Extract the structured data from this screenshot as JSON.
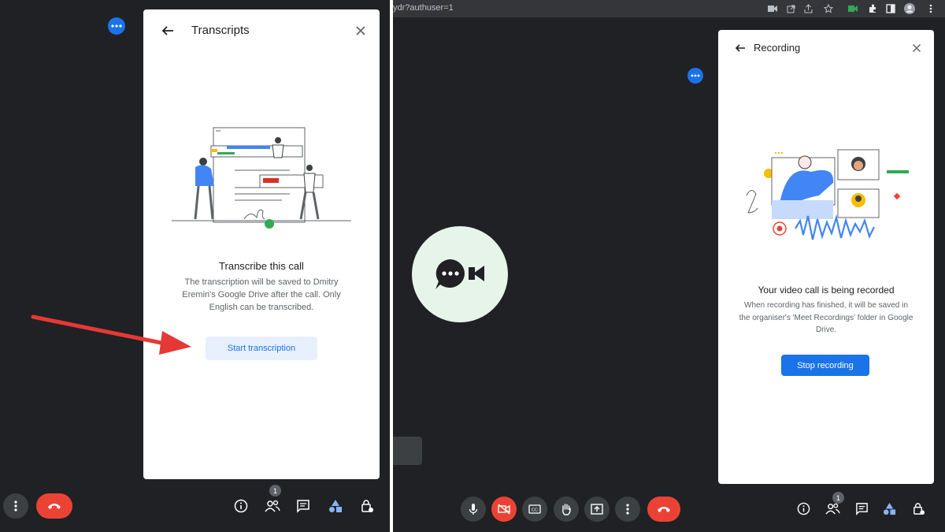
{
  "left": {
    "transcripts_panel": {
      "title": "Transcripts",
      "heading": "Transcribe this call",
      "description": "The transcription will be saved to Dmitry Eremin's Google Drive after the call. Only English can be transcribed.",
      "button_label": "Start transcription"
    },
    "participants_badge": "1"
  },
  "right": {
    "url_fragment": "ydr?authuser=1",
    "recording_panel": {
      "title": "Recording",
      "heading": "Your video call is being recorded",
      "description": "When recording has finished, it will be saved in the organiser's 'Meet Recordings' folder in Google Drive.",
      "button_label": "Stop recording"
    },
    "participants_badge": "1"
  },
  "colors": {
    "meet_background": "#202124",
    "accent_blue": "#1a73e8",
    "end_call_red": "#ea4335",
    "annotation_arrow": "#e53935"
  },
  "icons": [
    "more-options-icon",
    "back-arrow-icon",
    "close-icon",
    "end-call-icon",
    "info-icon",
    "people-icon",
    "chat-icon",
    "activities-icon",
    "host-controls-icon",
    "mic-icon",
    "camera-off-icon",
    "captions-icon",
    "raise-hand-icon",
    "present-icon",
    "chat-video-icon"
  ]
}
